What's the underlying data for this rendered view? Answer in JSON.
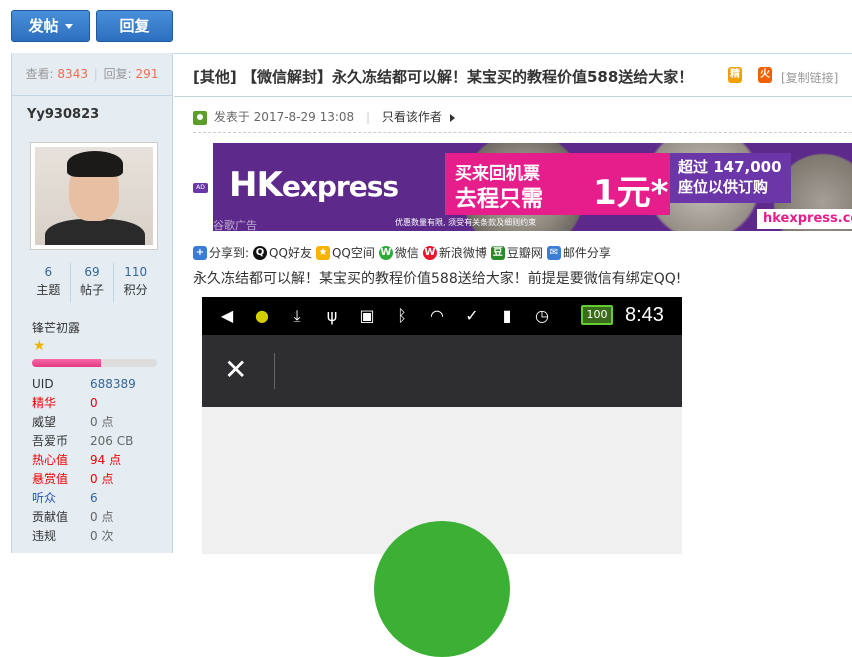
{
  "toolbar": {
    "post_label": "发帖",
    "reply_label": "回复"
  },
  "sidebar": {
    "views_label": "查看:",
    "views": "8343",
    "replies_label": "回复:",
    "replies": "291",
    "username": "Yy930823",
    "counts": [
      {
        "value": "6",
        "label": "主题"
      },
      {
        "value": "69",
        "label": "帖子"
      },
      {
        "value": "110",
        "label": "积分"
      }
    ],
    "rank": "锋芒初露",
    "rank_progress": 0.55,
    "info": [
      {
        "key": "UID",
        "value": "688389"
      },
      {
        "key": "精华",
        "value": "0"
      },
      {
        "key": "威望",
        "value": "0 点"
      },
      {
        "key": "吾爱币",
        "value": "206 CB"
      },
      {
        "key": "热心值",
        "value": "94 点"
      },
      {
        "key": "悬赏值",
        "value": "0 点"
      },
      {
        "key": "听众",
        "value": "6"
      },
      {
        "key": "贡献值",
        "value": "0 点"
      },
      {
        "key": "违规",
        "value": "0 次"
      }
    ]
  },
  "thread": {
    "category": "[其他]",
    "title": "【微信解封】永久冻结都可以解！某宝买的教程价值588送给大家！",
    "badge1": "精",
    "badge2": "火",
    "copy_link": "[复制链接]",
    "posted_prefix": "发表于",
    "posted_time": "2017-8-29 13:08",
    "author_only": "只看该作者"
  },
  "ad": {
    "tag": "AD",
    "brand_hk": "HK",
    "brand_express": "express",
    "line1": "买来回机票",
    "line2": "去程只需",
    "big": "1元*",
    "right1": "超过 147,000",
    "right2": "座位以供订购",
    "url": "hkexpress.co",
    "fine": "优惠数量有限, 须受有关条款及细则约束",
    "google": "谷歌广告"
  },
  "share": {
    "prefix": "分享到:",
    "items": [
      "QQ好友",
      "QQ空间",
      "微信",
      "新浪微博",
      "豆瓣网",
      "邮件分享"
    ]
  },
  "body": "永久冻结都可以解！某宝买的教程价值588送给大家！前提是要微信有绑定QQ!",
  "phone": {
    "time": "8:43",
    "battery": "100",
    "close": "✕"
  },
  "colors": {
    "accent": "#2c6fbf",
    "sidebar_bg": "#e5edf2",
    "stat_orange": "#f26c4f",
    "ad_purple": "#5d2a8c",
    "ad_pink": "#e61e8c",
    "wechat_green": "#3cb034"
  }
}
